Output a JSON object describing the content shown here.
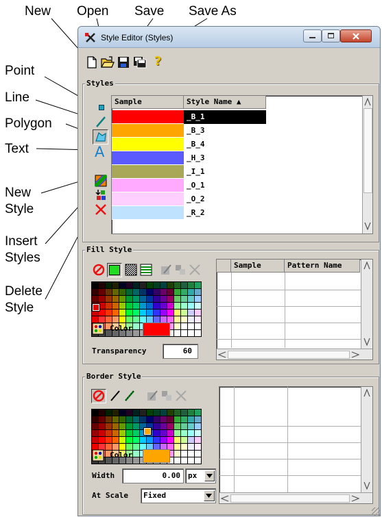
{
  "callouts": {
    "new": "New",
    "open": "Open",
    "save": "Save",
    "save_as": "Save As",
    "point": "Point",
    "line": "Line",
    "polygon": "Polygon",
    "text": "Text",
    "new_style_1": "New",
    "new_style_2": "Style",
    "insert_styles_1": "Insert",
    "insert_styles_2": "Styles",
    "delete_style_1": "Delete",
    "delete_style_2": "Style"
  },
  "window": {
    "title": "Style Editor (Styles)"
  },
  "styles_group": {
    "label": "Styles",
    "columns": [
      "Sample",
      "Style Name ▲"
    ],
    "rows": [
      {
        "name": "_B_1",
        "color": "#ff0000",
        "selected": true
      },
      {
        "name": "_B_3",
        "color": "#ffa500",
        "selected": false
      },
      {
        "name": "_B_4",
        "color": "#ffff00",
        "selected": false
      },
      {
        "name": "_H_3",
        "color": "#5a5aff",
        "selected": false
      },
      {
        "name": "_I_1",
        "color": "#a8a858",
        "selected": false
      },
      {
        "name": "_O_1",
        "color": "#ffaaff",
        "selected": false
      },
      {
        "name": "_O_2",
        "color": "#ffcfff",
        "selected": false
      },
      {
        "name": "_R_2",
        "color": "#bfe2ff",
        "selected": false
      }
    ]
  },
  "fill_style": {
    "label": "Fill Style",
    "color_label": "Color",
    "color": "#ff0000",
    "transparency_label": "Transparency",
    "transparency_value": "60",
    "pattern_columns": [
      "Sample",
      "Pattern Name"
    ]
  },
  "border_style": {
    "label": "Border Style",
    "color_label": "Color",
    "color": "#ffa500",
    "width_label": "Width",
    "width_value": "0.00",
    "unit_value": "px",
    "at_scale_label": "At Scale",
    "at_scale_value": "Fixed"
  },
  "help_icon_glyph": "?"
}
